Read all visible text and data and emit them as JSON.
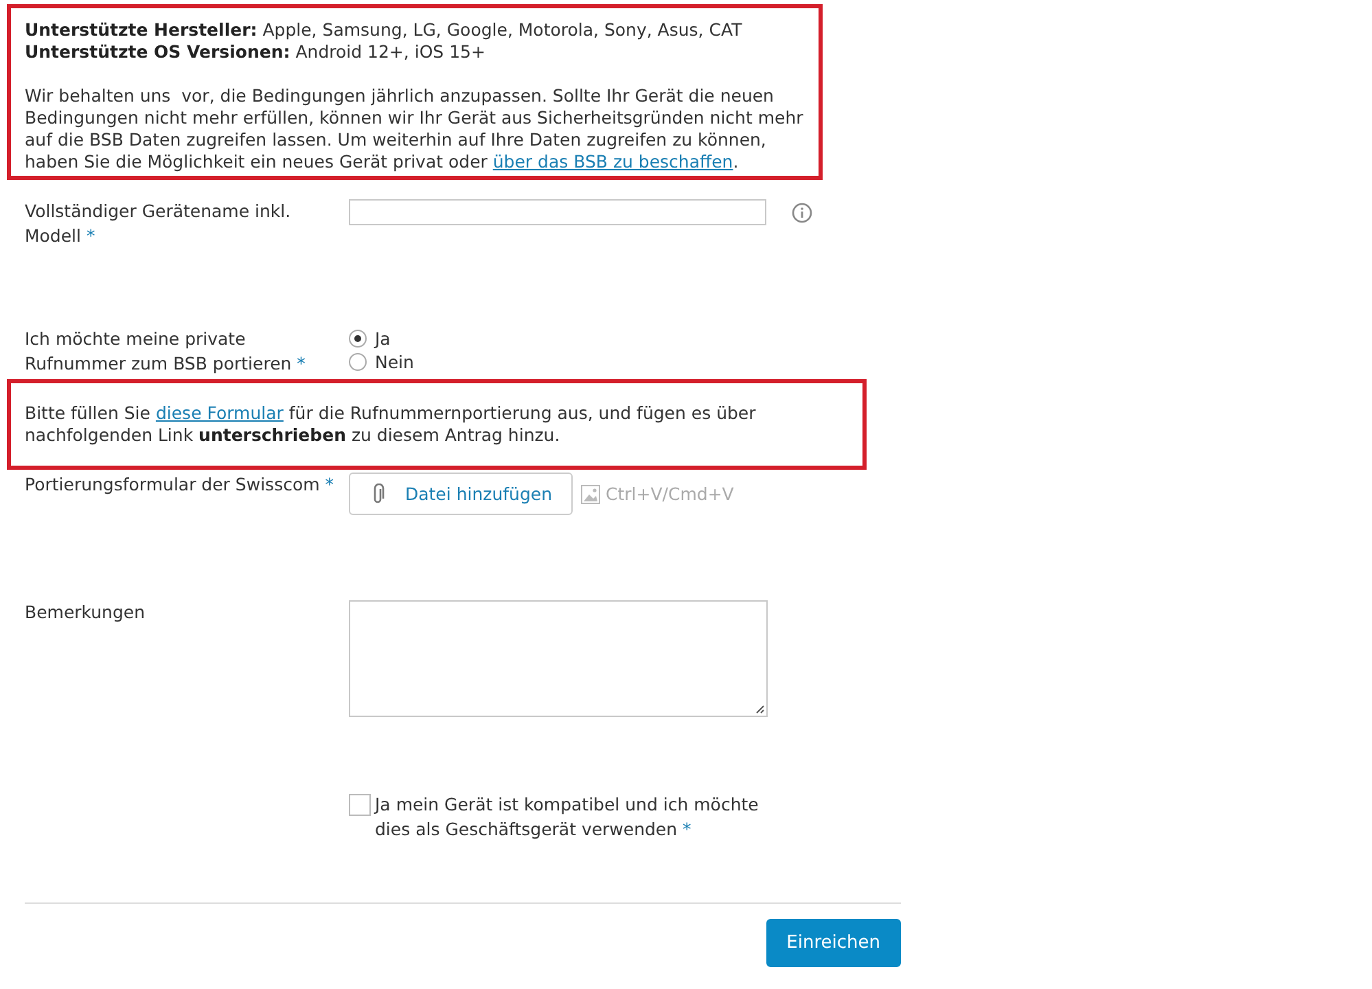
{
  "support_notice": {
    "lines": [
      "**Unterstützte Hersteller:** Apple, Samsung, LG, Google, Motorola, Sony, Asus, CAT",
      "**Unterstützte OS Versionen:** Android 12+, iOS 15+"
    ],
    "paragraph": {
      "before": "Wir behalten uns  vor, die Bedingungen jährlich anzupassen. Sollte Ihr Gerät die neuen Bedingungen nicht mehr erfüllen, können wir Ihr Gerät aus Sicherheitsgründen nicht mehr auf die BSB Daten zugreifen lassen. Um weiterhin auf Ihre Daten zugreifen zu können, haben Sie die Möglichkeit ein neues Gerät privat oder ",
      "link": "über das BSB zu beschaffen",
      "after": "."
    }
  },
  "device_name": {
    "label": "Vollständiger Gerätename inkl. Modell",
    "required_mark": "*"
  },
  "port_number": {
    "label": "Ich möchte meine private Rufnummer zum BSB portieren",
    "required_mark": "*",
    "options": [
      {
        "label": "Ja",
        "selected": true
      },
      {
        "label": "Nein",
        "selected": false
      }
    ]
  },
  "port_notice": {
    "before": "Bitte füllen Sie ",
    "link": "diese Formular",
    "after": " für die Rufnummernportierung aus, und fügen es über nachfolgenden Link **unterschrieben** zu diesem Antrag hinzu."
  },
  "port_form": {
    "label": "Portierungsformular der Swisscom",
    "required_mark": "*",
    "button": "Datei hinzufügen",
    "paste_hint": "Ctrl+V/Cmd+V"
  },
  "remarks": {
    "label": "Bemerkungen"
  },
  "confirm": {
    "label": "Ja mein Gerät ist kompatibel und ich möchte dies als Geschäftsgerät verwenden",
    "required_mark": "*",
    "checked": false
  },
  "submit": "Einreichen"
}
